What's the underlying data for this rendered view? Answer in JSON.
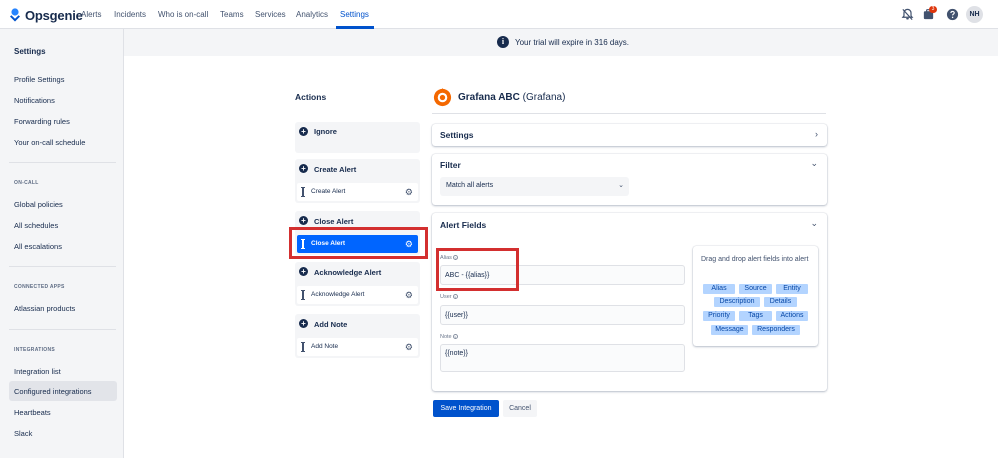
{
  "app": {
    "name": "Opsgenie"
  },
  "nav": {
    "items": [
      "Alerts",
      "Incidents",
      "Who is on-call",
      "Teams",
      "Services",
      "Analytics",
      "Settings"
    ]
  },
  "topbar": {
    "notification_count": "3",
    "avatar_initials": "NH"
  },
  "sidebar": {
    "title": "Settings",
    "personal": [
      "Profile Settings",
      "Notifications",
      "Forwarding rules",
      "Your on-call schedule"
    ],
    "oncall_section": "ON-CALL",
    "oncall": [
      "Global policies",
      "All schedules",
      "All escalations"
    ],
    "apps_section": "CONNECTED APPS",
    "apps": [
      "Atlassian products"
    ],
    "integrations_section": "INTEGRATIONS",
    "integrations": [
      "Integration list",
      "Configured integrations",
      "Heartbeats",
      "Slack"
    ]
  },
  "banner": {
    "text": "Your trial will expire in 316 days."
  },
  "actions": {
    "title": "Actions",
    "groups": [
      {
        "label": "Ignore",
        "rows": []
      },
      {
        "label": "Create Alert",
        "rows": [
          "Create Alert"
        ]
      },
      {
        "label": "Close Alert",
        "rows": [
          "Close Alert"
        ]
      },
      {
        "label": "Acknowledge Alert",
        "rows": [
          "Acknowledge Alert"
        ]
      },
      {
        "label": "Add Note",
        "rows": [
          "Add Note"
        ]
      }
    ]
  },
  "integration": {
    "name": "Grafana ABC",
    "type": "(Grafana)"
  },
  "panels": {
    "settings_title": "Settings",
    "filter_title": "Filter",
    "filter_value": "Match all alerts",
    "alert_fields_title": "Alert Fields"
  },
  "fields": [
    {
      "label": "Alias",
      "value": "ABC - {{alias}}"
    },
    {
      "label": "User",
      "value": "{{user}}"
    },
    {
      "label": "Note",
      "value": "{{note}}"
    }
  ],
  "dnd": {
    "hint": "Drag and drop alert fields into alert",
    "chips": [
      "Alias",
      "Source",
      "Entity",
      "Description",
      "Details",
      "Priority",
      "Tags",
      "Actions",
      "Message",
      "Responders"
    ]
  },
  "buttons": {
    "save": "Save Integration",
    "cancel": "Cancel"
  },
  "colors": {
    "accent": "#0052cc",
    "selected_row": "#0065ff",
    "highlight": "#d32f2f",
    "chip_bg": "#b3d4ff"
  }
}
